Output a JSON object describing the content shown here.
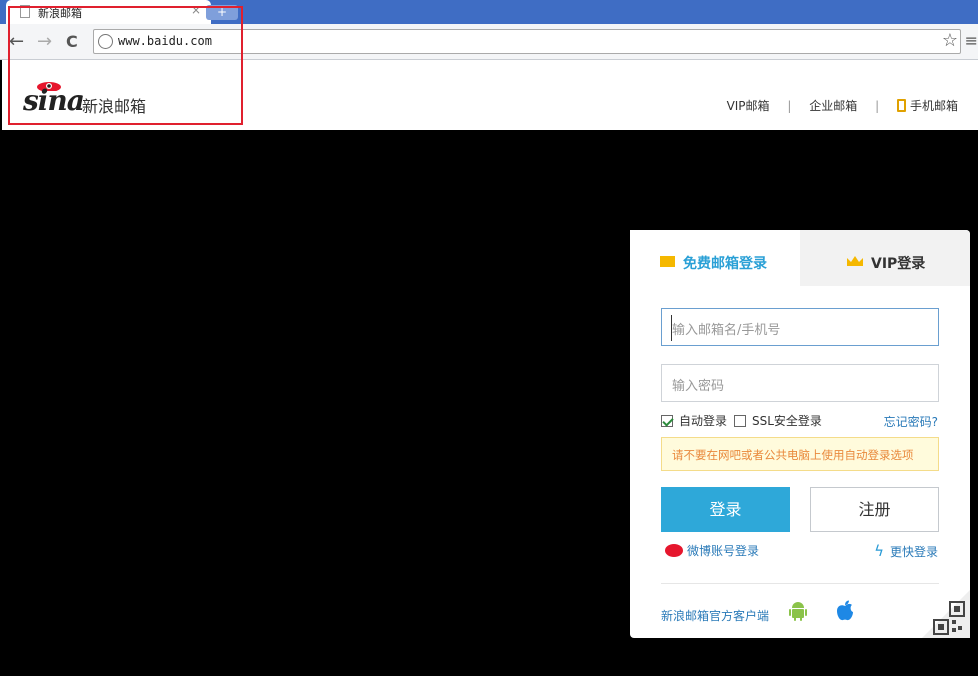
{
  "browser": {
    "tab_title": "新浪邮箱",
    "tab_close": "×",
    "new_tab": "+",
    "url": "www.baidu.com",
    "back": "←",
    "forward": "→",
    "reload": "C",
    "star": "☆",
    "menu": "≡"
  },
  "header": {
    "logo_brand": "sina",
    "logo_text": "新浪邮箱",
    "links": {
      "vip": "VIP邮箱",
      "enterprise": "企业邮箱",
      "mobile": "手机邮箱",
      "separator": "|"
    }
  },
  "login": {
    "tab_free": "免费邮箱登录",
    "tab_vip": "VIP登录",
    "user_placeholder": "输入邮箱名/手机号",
    "password_placeholder": "输入密码",
    "auto_login": "自动登录",
    "auto_login_checked": true,
    "ssl_login": "SSL安全登录",
    "ssl_login_checked": false,
    "forgot": "忘记密码?",
    "warning": "请不要在网吧或者公共电脑上使用自动登录选项",
    "login_button": "登录",
    "register_button": "注册",
    "weibo_login": "微博账号登录",
    "quick_login": "更快登录",
    "client_link": "新浪邮箱官方客户端"
  },
  "colors": {
    "accent": "#2ea8d9",
    "warning_text": "#e9893c",
    "highlight_box": "#e0202e"
  }
}
